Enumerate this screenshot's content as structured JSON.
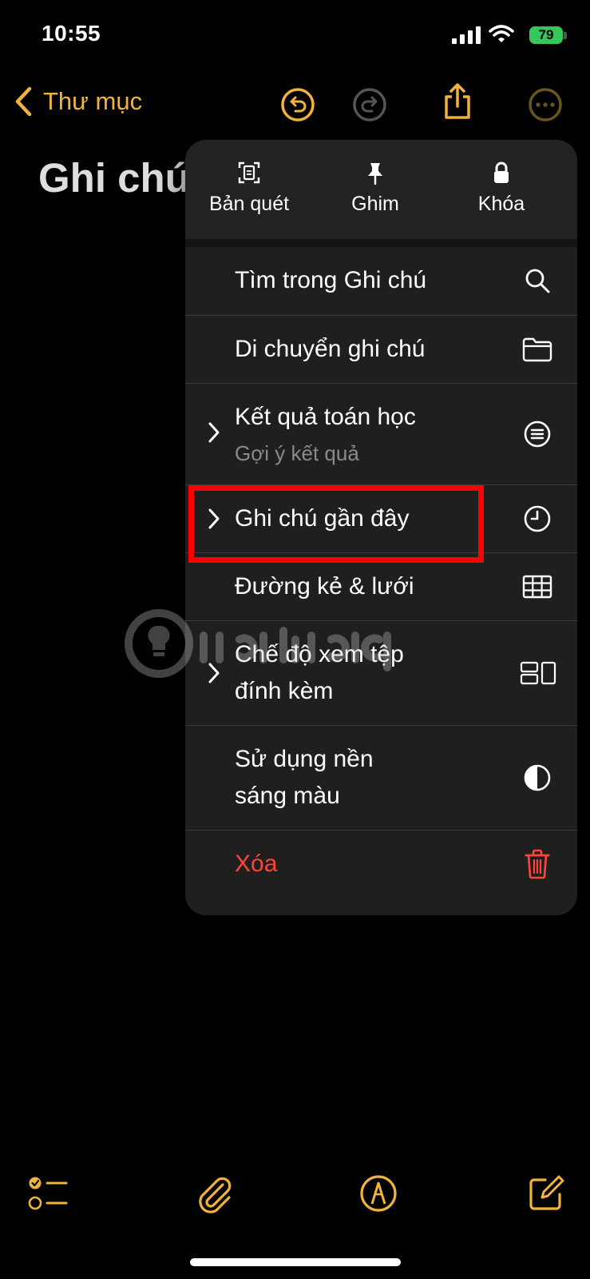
{
  "status_bar": {
    "time": "10:55",
    "battery": "79"
  },
  "nav": {
    "back_label": "Thư mục"
  },
  "note": {
    "title": "Ghi chú"
  },
  "menu": {
    "top_actions": [
      {
        "label": "Bản quét",
        "icon": "scan-document-icon"
      },
      {
        "label": "Ghim",
        "icon": "pin-icon"
      },
      {
        "label": "Khóa",
        "icon": "lock-icon"
      }
    ],
    "items": [
      {
        "label": "Tìm trong Ghi chú",
        "icon": "search-icon"
      },
      {
        "label": "Di chuyển ghi chú",
        "icon": "folder-icon"
      },
      {
        "label": "Kết quả toán học",
        "sublabel": "Gợi ý kết quả",
        "icon": "equals-circle-icon",
        "submenu": true
      },
      {
        "label": "Ghi chú gần đây",
        "icon": "clock-icon",
        "submenu": true
      },
      {
        "label": "Đường kẻ & lưới",
        "icon": "grid-icon"
      },
      {
        "label_line1": "Chế độ xem tệp",
        "label_line2": "đính kèm",
        "icon": "attachment-view-icon",
        "submenu": true
      },
      {
        "label_line1": "Sử dụng nền",
        "label_line2": "sáng màu",
        "icon": "contrast-icon"
      },
      {
        "label": "Xóa",
        "icon": "trash-icon",
        "destructive": true
      }
    ]
  },
  "colors": {
    "accent": "#f2b33d",
    "destructive": "#ff453a",
    "menu_bg": "#1f1f1f",
    "highlight": "#ff0000"
  }
}
